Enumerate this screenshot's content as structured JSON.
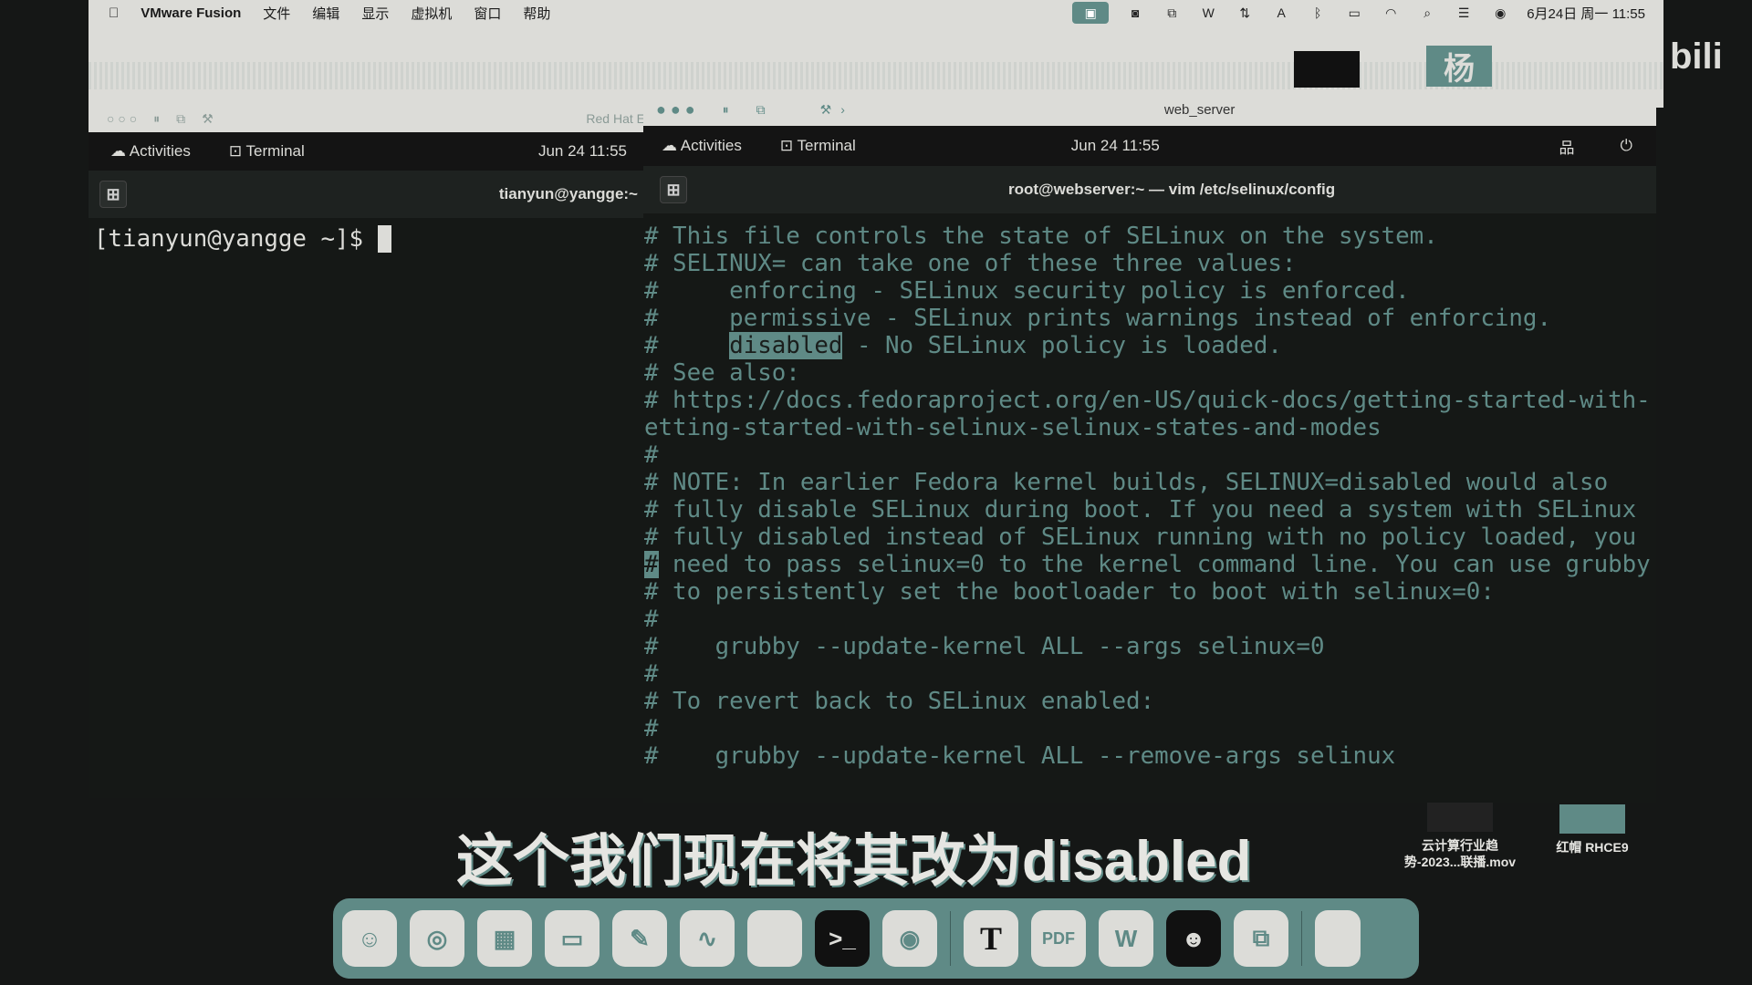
{
  "menubar": {
    "app": "VMware Fusion",
    "items": [
      "文件",
      "编辑",
      "显示",
      "虚拟机",
      "窗口",
      "帮助"
    ],
    "datetime": "6月24日 周一 11:55"
  },
  "left_vm": {
    "toolbar_title": "Red Hat E",
    "activities": "Activities",
    "terminal": "Terminal",
    "clock": "Jun 24  11:55",
    "title": "tianyun@yangge:~",
    "prompt": "[tianyun@yangge ~]$ "
  },
  "right_vm": {
    "toolbar_title": "web_server",
    "activities": "Activities",
    "terminal": "Terminal",
    "clock": "Jun 24  11:55",
    "title": "root@webserver:~ — vim /etc/selinux/config",
    "lines": [
      "# This file controls the state of SELinux on the system.",
      "# SELINUX= can take one of these three values:",
      "#     enforcing - SELinux security policy is enforced.",
      "#     permissive - SELinux prints warnings instead of enforcing.",
      "#     ",
      "# See also:",
      "# https://docs.fedoraproject.org/en-US/quick-docs/getting-started-with-",
      "etting-started-with-selinux-selinux-states-and-modes",
      "#",
      "# NOTE: In earlier Fedora kernel builds, SELINUX=disabled would also",
      "# fully disable SELinux during boot. If you need a system with SELinux",
      "# fully disabled instead of SELinux running with no policy loaded, you",
      "#",
      "# to persistently set the bootloader to boot with selinux=0:",
      "#",
      "#    grubby --update-kernel ALL --args selinux=0",
      "#",
      "# To revert back to SELinux enabled:",
      "#",
      "#    grubby --update-kernel ALL --remove-args selinux"
    ],
    "line5_highlight": "disabled",
    "line5_rest": " - No SELinux policy is loaded.",
    "line13_rest": " need to pass selinux=0 to the kernel command line. You can use grubby"
  },
  "subtitle": "这个我们现在将其改为disabled",
  "banner_logo": "杨",
  "watermark": "bili",
  "desktop": [
    {
      "label1": "云计算行业趋",
      "label2": "势-2023...联播.mov"
    },
    {
      "label1": "红帽 RHCE9",
      "label2": ""
    }
  ],
  "dock": [
    "finder-icon",
    "safari-icon",
    "launchpad-icon",
    "preview-icon",
    "script-editor-icon",
    "freeform-icon",
    "notes-icon",
    "terminal-icon",
    "chrome-icon",
    "typora-icon",
    "pdf-icon",
    "wps-icon",
    "chat-icon",
    "vmware-icon",
    "trash-icon"
  ],
  "dock_glyphs": {
    "typora": "T",
    "pdf": "PDF",
    "wps": "W",
    "terminal": ">_"
  },
  "colors": {
    "accent": "#5f8a86",
    "bg": "#151816",
    "menubar": "#dcdcd8"
  }
}
